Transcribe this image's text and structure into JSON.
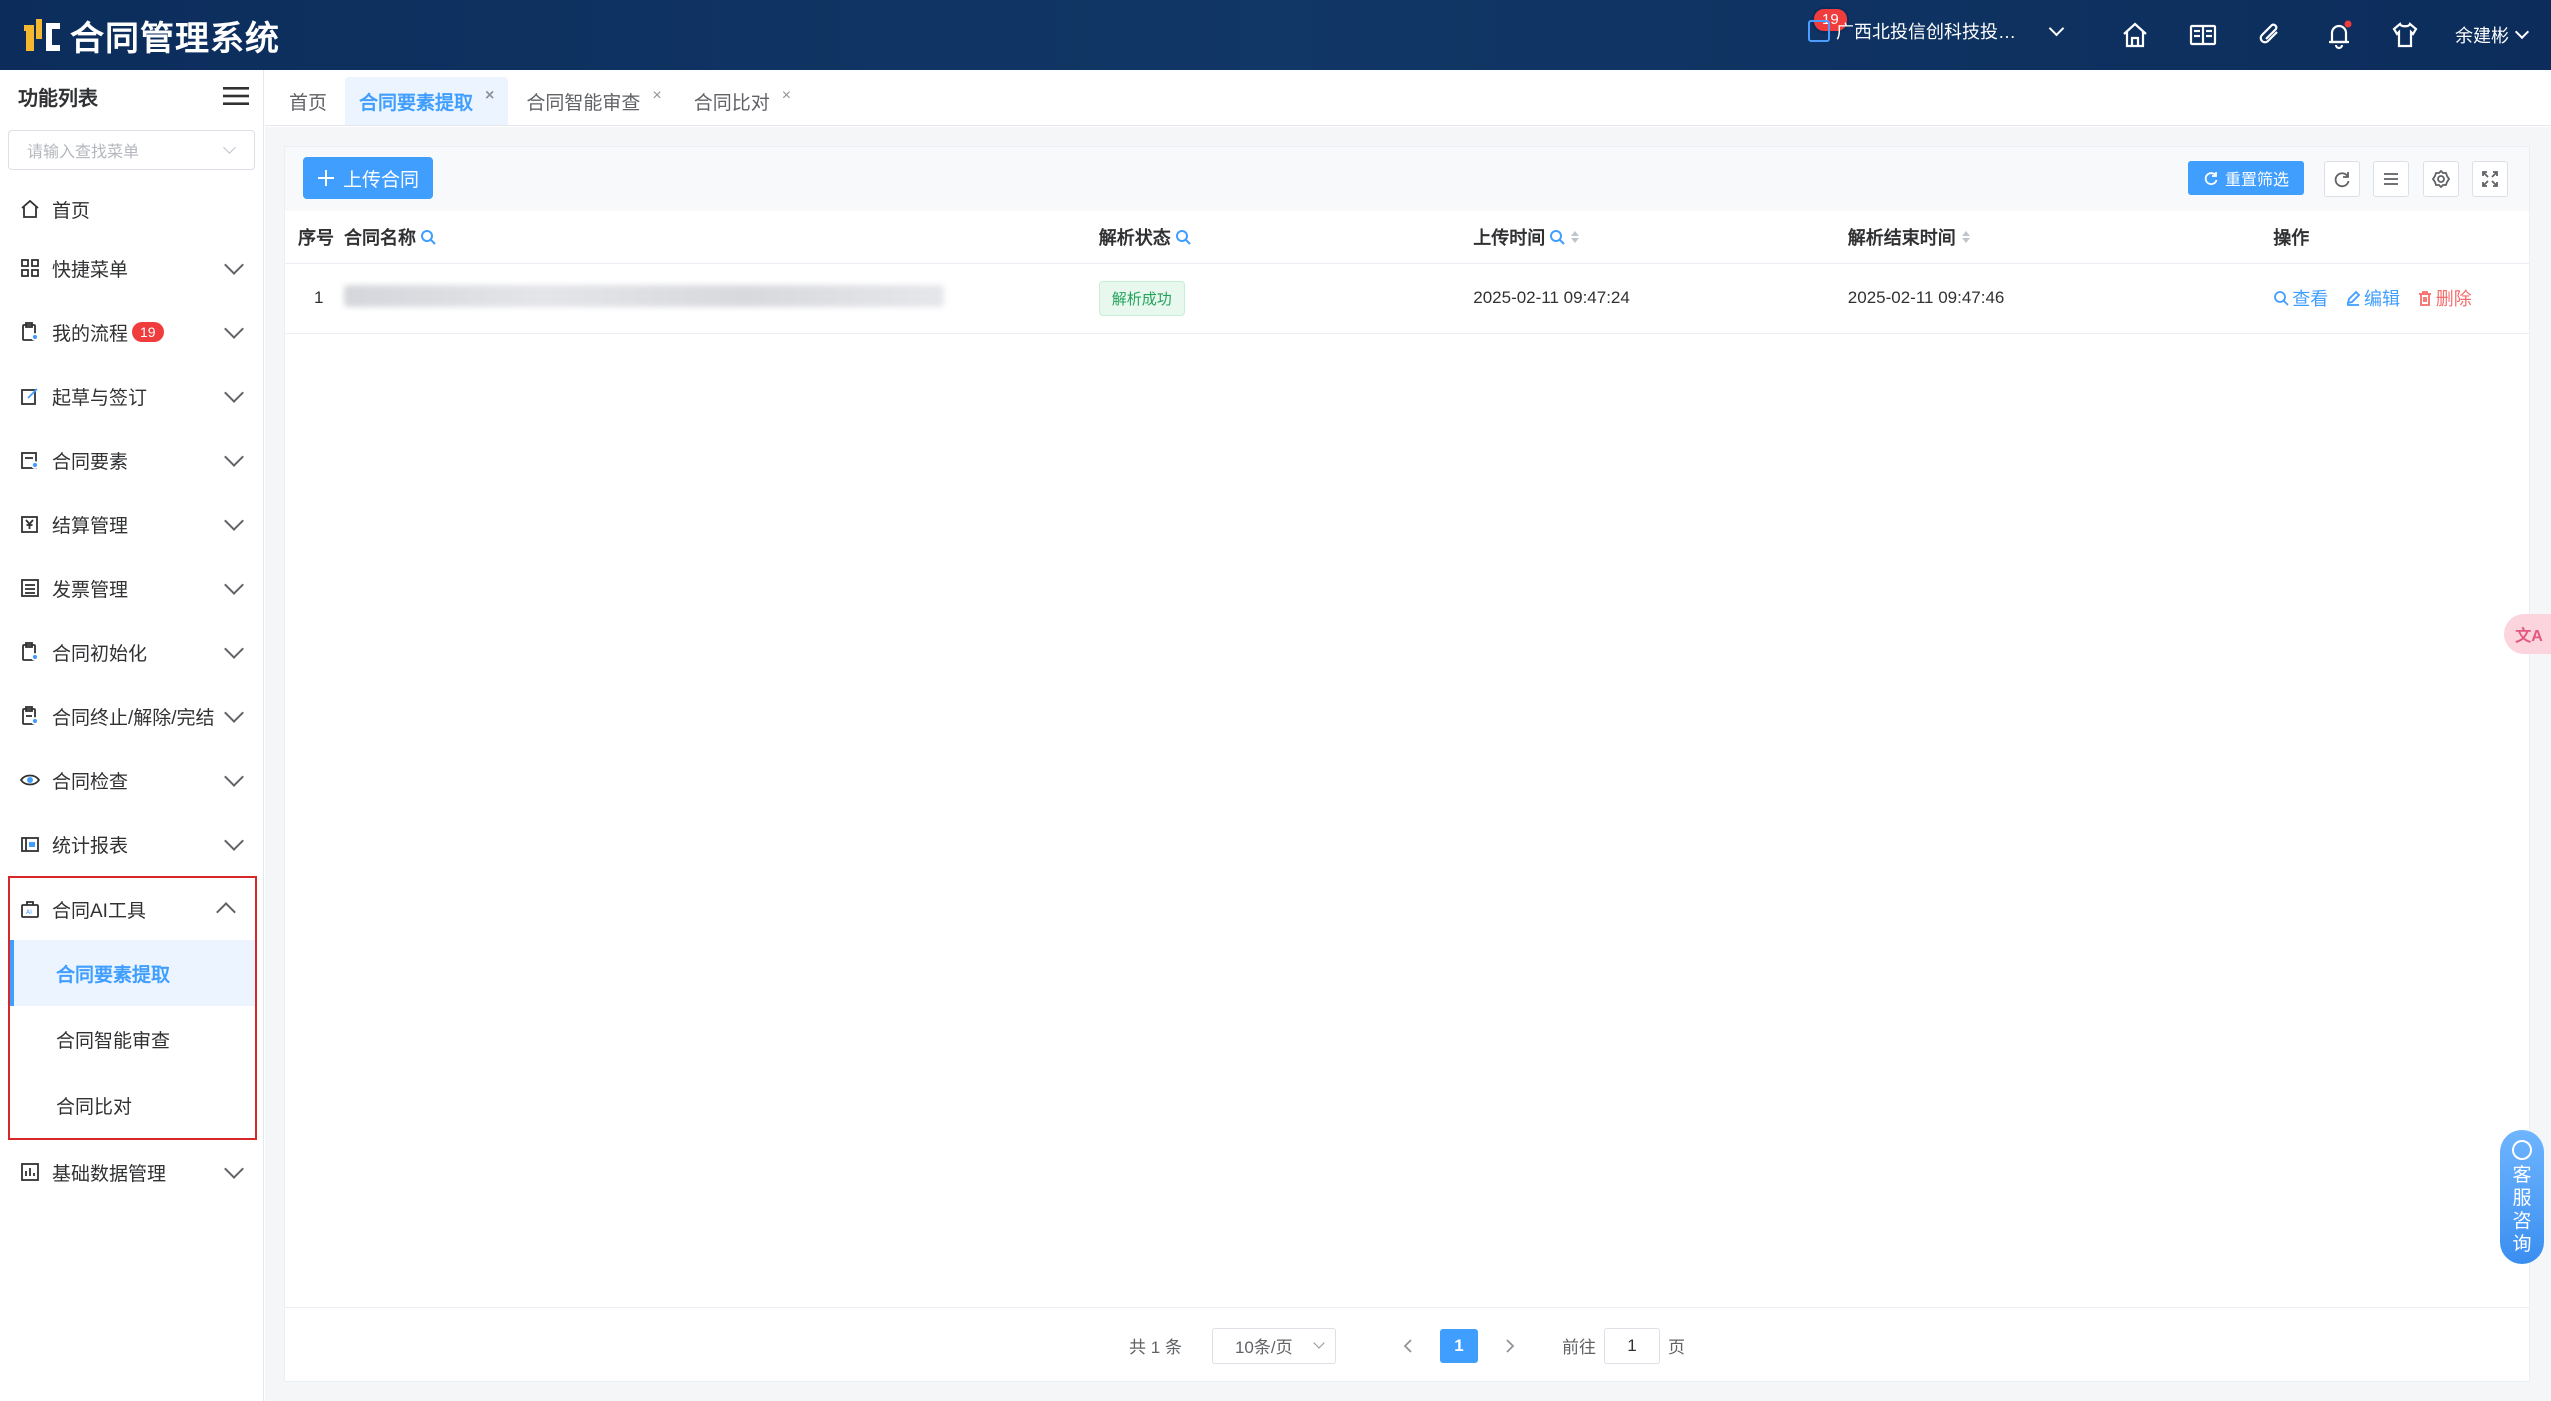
{
  "header": {
    "title": "合同管理系统",
    "company": "广西北投信创科技投资集...",
    "company_badge": "19",
    "user": "余建彬",
    "icons": [
      "home-icon",
      "book-icon",
      "paperclip-icon",
      "bell-icon",
      "shirt-icon"
    ]
  },
  "sidebar": {
    "title": "功能列表",
    "search_placeholder": "请输入查找菜单",
    "items": [
      {
        "label": "首页",
        "icon": "home-icon"
      },
      {
        "label": "快捷菜单",
        "icon": "grid-icon"
      },
      {
        "label": "我的流程",
        "icon": "clipboard-icon",
        "badge": "19"
      },
      {
        "label": "起草与签订",
        "icon": "edit-icon"
      },
      {
        "label": "合同要素",
        "icon": "document-icon"
      },
      {
        "label": "结算管理",
        "icon": "yen-icon"
      },
      {
        "label": "发票管理",
        "icon": "list-icon"
      },
      {
        "label": "合同初始化",
        "icon": "clipboard-clock-icon"
      },
      {
        "label": "合同终止/解除/完结",
        "icon": "clipboard-check-icon"
      },
      {
        "label": "合同检查",
        "icon": "eye-icon"
      },
      {
        "label": "统计报表",
        "icon": "report-icon"
      }
    ],
    "ai_group": {
      "label": "合同AI工具",
      "children": [
        "合同要素提取",
        "合同智能审查",
        "合同比对"
      ]
    },
    "last_item": {
      "label": "基础数据管理",
      "icon": "chart-icon"
    }
  },
  "tabs": [
    {
      "label": "首页"
    },
    {
      "label": "合同要素提取",
      "active": true,
      "closable": true
    },
    {
      "label": "合同智能审查",
      "closable": true
    },
    {
      "label": "合同比对",
      "closable": true
    }
  ],
  "toolbar": {
    "upload": "上传合同",
    "reset": "重置筛选"
  },
  "table": {
    "columns": [
      "序号",
      "合同名称",
      "解析状态",
      "上传时间",
      "解析结束时间",
      "操作"
    ],
    "rows": [
      {
        "index": "1",
        "status": "解析成功",
        "upload_time": "2025-02-11 09:47:24",
        "end_time": "2025-02-11 09:47:46"
      }
    ],
    "actions": {
      "view": "查看",
      "edit": "编辑",
      "delete": "删除"
    }
  },
  "pagination": {
    "total": "共 1 条",
    "page_size": "10条/页",
    "current": "1",
    "goto_prefix": "前往",
    "goto_value": "1",
    "goto_suffix": "页"
  },
  "float": {
    "translate": "文A",
    "service": [
      "客",
      "服",
      "咨",
      "询"
    ]
  },
  "colors": {
    "primary": "#409eff",
    "header_bg": "#0c2d5c",
    "danger": "#f56c6c",
    "success": "#22a35a",
    "highlight_border": "#d62828"
  }
}
